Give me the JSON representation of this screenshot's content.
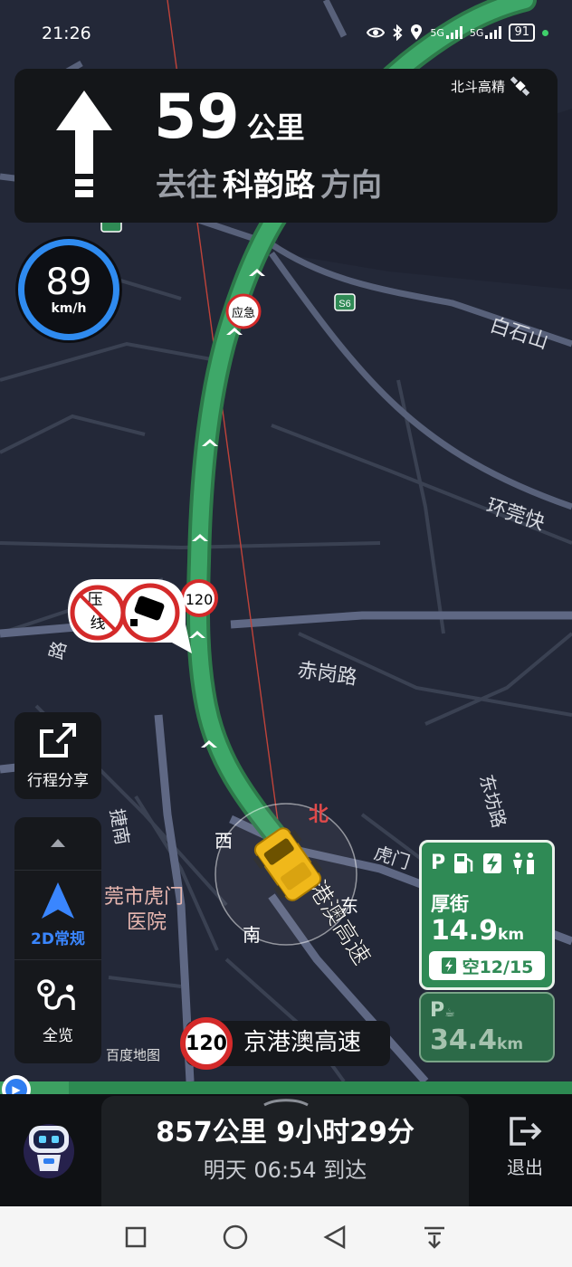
{
  "status_bar": {
    "time": "21:26",
    "signal1": "5G",
    "signal2": "5G",
    "battery": "91"
  },
  "navigation": {
    "distance_value": "59",
    "distance_unit": "公里",
    "direction_prefix": "去往",
    "road_name": "科韵路",
    "direction_suffix": "方向",
    "positioning": "北斗高精"
  },
  "speed": {
    "value": "89",
    "unit": "km/h"
  },
  "map": {
    "labels": {
      "road_s6": "S6",
      "baishishan": "白石山",
      "huanguan": "环莞快",
      "chigang": "赤岗路",
      "dongfang": "东坊路",
      "jienan": "捷南",
      "hospital_line1": "莞市虎门",
      "hospital_line2": "医院",
      "humen": "虎门",
      "jinggangao": "港澳高速",
      "lu_left": "路",
      "emergency": "应急",
      "speed_limit_sign": "120",
      "no_line_top": "压",
      "no_line_bottom": "线"
    },
    "compass": {
      "north": "北",
      "west": "西",
      "east": "东",
      "south": "南"
    }
  },
  "left_controls": {
    "share_label": "行程分享",
    "mode_label": "2D常规",
    "overview_label": "全览"
  },
  "service_area": {
    "next_name": "厚街",
    "next_distance": "14.9",
    "next_distance_unit": "km",
    "charging_status": "空12/15",
    "following_distance": "34.4",
    "following_distance_unit": "km"
  },
  "current_road": {
    "speed_limit": "120",
    "name": "京港澳高速",
    "brand": "百度地图"
  },
  "trip_summary": {
    "summary": "857公里 9小时29分",
    "eta": "明天 06:54 到达",
    "progress_fraction": 0.12
  },
  "bottom": {
    "exit_label": "退出"
  },
  "colors": {
    "route_green": "#3a9a5c",
    "accent_blue": "#2f8bf0",
    "service_green": "#2f8a55",
    "limit_red": "#d42a2a"
  }
}
